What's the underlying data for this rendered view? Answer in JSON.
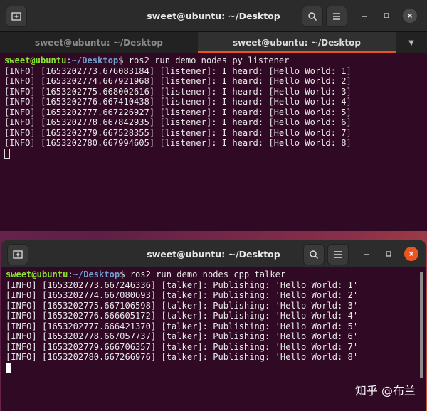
{
  "window1": {
    "title": "sweet@ubuntu: ~/Desktop",
    "tabs": [
      {
        "label": "sweet@ubuntu: ~/Desktop"
      },
      {
        "label": "sweet@ubuntu: ~/Desktop"
      }
    ],
    "prompt": {
      "user": "sweet@ubuntu",
      "path": "~/Desktop",
      "symbol": "$",
      "command": " ros2 run demo_nodes_py listener"
    },
    "lines": [
      "[INFO] [1653202773.676083184] [listener]: I heard: [Hello World: 1]",
      "[INFO] [1653202774.667921968] [listener]: I heard: [Hello World: 2]",
      "[INFO] [1653202775.668002616] [listener]: I heard: [Hello World: 3]",
      "[INFO] [1653202776.667410438] [listener]: I heard: [Hello World: 4]",
      "[INFO] [1653202777.667226927] [listener]: I heard: [Hello World: 5]",
      "[INFO] [1653202778.667842935] [listener]: I heard: [Hello World: 6]",
      "[INFO] [1653202779.667528355] [listener]: I heard: [Hello World: 7]",
      "[INFO] [1653202780.667994605] [listener]: I heard: [Hello World: 8]"
    ]
  },
  "window2": {
    "title": "sweet@ubuntu: ~/Desktop",
    "prompt": {
      "user": "sweet@ubuntu",
      "path": "~/Desktop",
      "symbol": "$",
      "command": " ros2 run demo_nodes_cpp talker"
    },
    "lines": [
      "[INFO] [1653202773.667246336] [talker]: Publishing: 'Hello World: 1'",
      "[INFO] [1653202774.667080693] [talker]: Publishing: 'Hello World: 2'",
      "[INFO] [1653202775.667106598] [talker]: Publishing: 'Hello World: 3'",
      "[INFO] [1653202776.666605172] [talker]: Publishing: 'Hello World: 4'",
      "[INFO] [1653202777.666421370] [talker]: Publishing: 'Hello World: 5'",
      "[INFO] [1653202778.667057737] [talker]: Publishing: 'Hello World: 6'",
      "[INFO] [1653202779.666706357] [talker]: Publishing: 'Hello World: 7'",
      "[INFO] [1653202780.667266976] [talker]: Publishing: 'Hello World: 8'"
    ]
  },
  "watermark": "知乎 @布兰",
  "colors": {
    "terminal_bg": "#300a24",
    "prompt_user": "#8ae234",
    "prompt_path": "#729fcf",
    "close_button": "#e95420",
    "tab_accent": "#e95420"
  }
}
